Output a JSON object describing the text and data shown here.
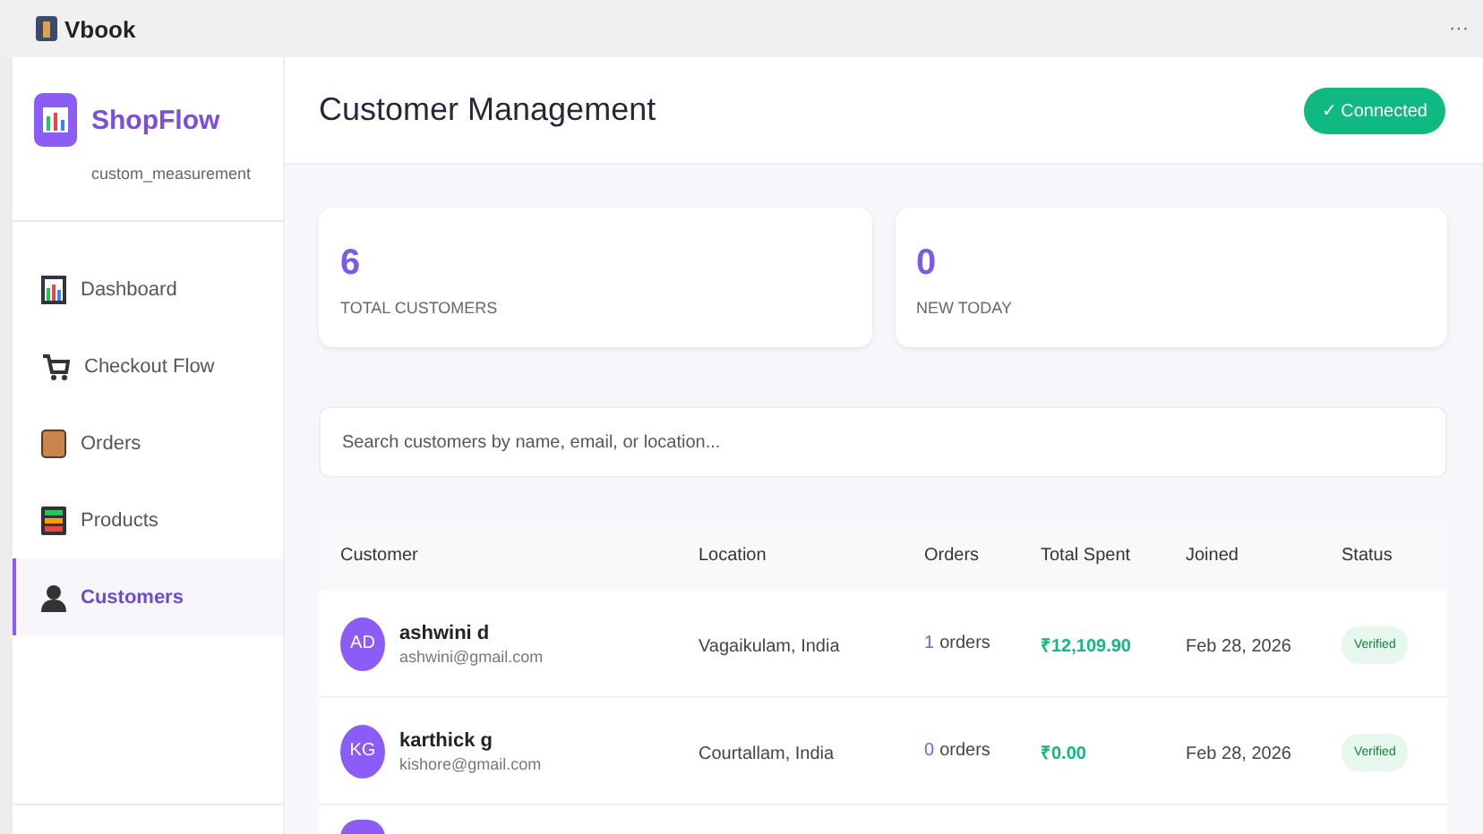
{
  "window": {
    "title": "Vbook",
    "menu": "···"
  },
  "brand": {
    "name": "ShopFlow",
    "subtitle": "custom_measurement"
  },
  "nav": [
    {
      "label": "Dashboard",
      "selected": false
    },
    {
      "label": "Checkout Flow",
      "selected": false
    },
    {
      "label": "Orders",
      "selected": false
    },
    {
      "label": "Products",
      "selected": false
    },
    {
      "label": "Customers",
      "selected": true
    }
  ],
  "header": {
    "title": "Customer Management",
    "status": "✓ Connected"
  },
  "stats": [
    {
      "value": "6",
      "label": "TOTAL CUSTOMERS"
    },
    {
      "value": "0",
      "label": "NEW TODAY"
    }
  ],
  "search": {
    "placeholder": "Search customers by name, email, or location..."
  },
  "table": {
    "columns": [
      "Customer",
      "Location",
      "Orders",
      "Total Spent",
      "Joined",
      "Status"
    ],
    "rows": [
      {
        "initials": "AD",
        "name": "ashwini d",
        "email": "ashwini@gmail.com",
        "location": "Vagaikulam, India",
        "orders": "1",
        "orders_unit": "orders",
        "spent": "₹12,109.90",
        "joined": "Feb 28, 2026",
        "status": "Verified"
      },
      {
        "initials": "KG",
        "name": "karthick g",
        "email": "kishore@gmail.com",
        "location": "Courtallam, India",
        "orders": "0",
        "orders_unit": "orders",
        "spent": "₹0.00",
        "joined": "Feb 28, 2026",
        "status": "Verified"
      },
      {
        "kind": "cut"
      }
    ]
  }
}
